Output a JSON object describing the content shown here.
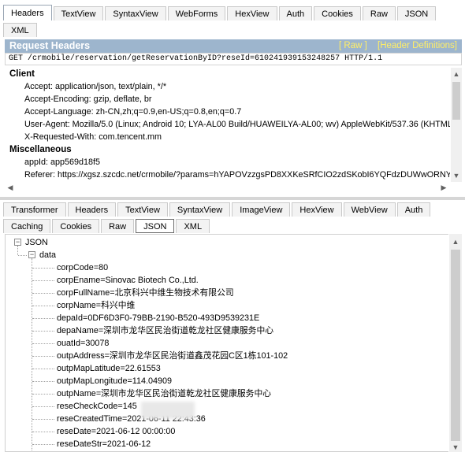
{
  "top_tabs": {
    "row1": [
      "Headers",
      "TextView",
      "SyntaxView",
      "WebForms",
      "HexView",
      "Auth",
      "Cookies",
      "Raw",
      "JSON"
    ],
    "row2": [
      "XML"
    ],
    "active": "Headers"
  },
  "request_headers": {
    "title": "Request Headers",
    "raw_link": "[ Raw ]",
    "defs_link": "[Header Definitions]",
    "request_line": "GET /crmobile/reservation/getReservationByID?reseId=610241939153248257 HTTP/1.1",
    "groups": [
      {
        "name": "Client",
        "rows": [
          "Accept: application/json, text/plain, */*",
          "Accept-Encoding: gzip, deflate, br",
          "Accept-Language: zh-CN,zh;q=0.9,en-US;q=0.8,en;q=0.7",
          "User-Agent: Mozilla/5.0 (Linux; Android 10; LYA-AL00 Build/HUAWEILYA-AL00; wv) AppleWebKit/537.36 (KHTML",
          "X-Requested-With: com.tencent.mm"
        ]
      },
      {
        "name": "Miscellaneous",
        "rows": [
          "appId: app569d18f5",
          "Referer: https://xgsz.szcdc.net/crmobile/?params=hYAPOVzzgsPD8XXKeSRfCIO2zdSKobI6YQFdzDUWwORNYoT"
        ]
      }
    ]
  },
  "bottom_tabs": {
    "row1": [
      "Transformer",
      "Headers",
      "TextView",
      "SyntaxView",
      "ImageView",
      "HexView",
      "WebView",
      "Auth"
    ],
    "row2": [
      "Caching",
      "Cookies",
      "Raw",
      "JSON",
      "XML"
    ],
    "active": "JSON"
  },
  "json_tree": {
    "root": "JSON",
    "child": "data",
    "items": [
      "corpCode=80",
      "corpEname=Sinovac Biotech Co.,Ltd.",
      "corpFullName=北京科兴中维生物技术有限公司",
      "corpName=科兴中维",
      "depaId=0DF6D3F0-79BB-2190-B520-493D9539231E",
      "depaName=深圳市龙华区民治街道乾龙社区健康服务中心",
      "ouatId=30078",
      "outpAddress=深圳市龙华区民治街道鑫茂花园C区1栋101-102",
      "outpMapLatitude=22.61553",
      "outpMapLongitude=114.04909",
      "outpName=深圳市龙华区民治街道乾龙社区健康服务中心",
      "reseCheckCode=145",
      "reseCreatedTime=2021-06-11 22:43:36",
      "reseDate=2021-06-12 00:00:00",
      "reseDateStr=2021-06-12"
    ]
  },
  "icons": {
    "expand_toggle": "minus-box-icon",
    "scroll_up": "chevron-up-icon",
    "scroll_down": "chevron-down-icon",
    "scroll_left": "chevron-left-icon",
    "scroll_right": "chevron-right-icon"
  },
  "colors": {
    "header_bar": "#9db5cd",
    "header_links": "#ffee66"
  }
}
